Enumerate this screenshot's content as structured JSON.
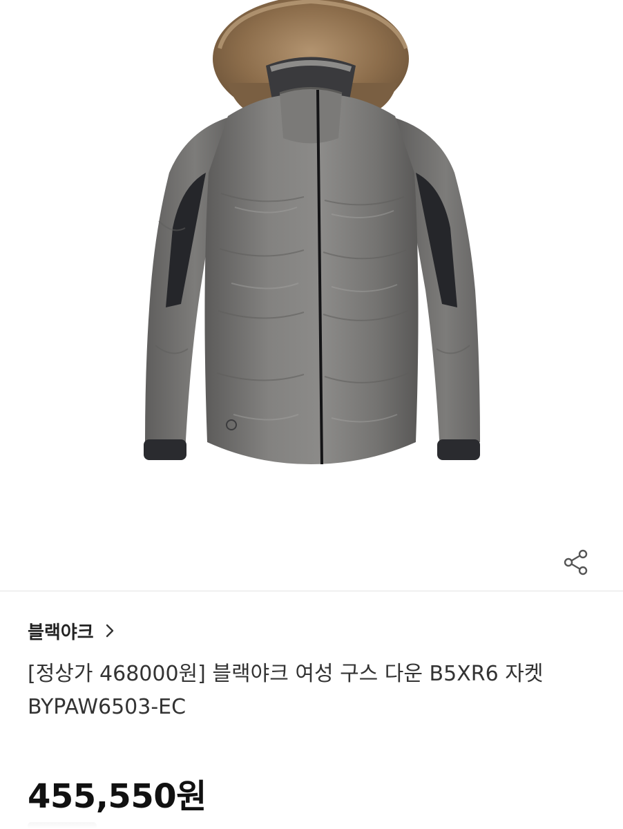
{
  "product": {
    "image_name": "grey-down-jacket-with-fur-hood",
    "brand": "블랙야크",
    "title": "[정상가 468000원] 블랙야크 여성 구스 다운 B5XR6 자켓 BYPAW6503-EC",
    "price": "455,550원"
  },
  "icons": {
    "share": "share-icon",
    "brand_chevron": "chevron-right-icon"
  },
  "colors": {
    "jacket": "#6f6e6c",
    "jacket_dark": "#2b2c30",
    "fur": "#9a7a55",
    "divider": "#e3e3e3",
    "text": "#222222"
  }
}
